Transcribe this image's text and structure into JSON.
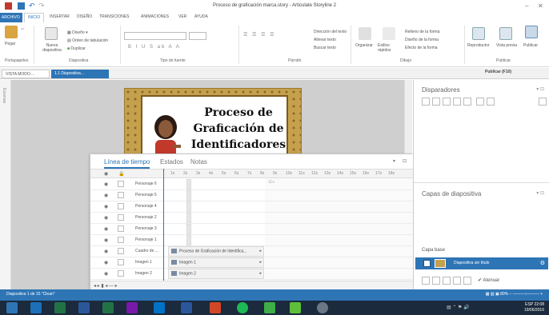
{
  "window": {
    "title": "Proceso de graficación marca.story - Articulate Storyline 2"
  },
  "ribbon_tabs": [
    "ARCHIVO",
    "INICIO",
    "INSERTAR",
    "DISEÑO",
    "TRANSICIONES",
    "ANIMACIONES",
    "VER",
    "AYUDA"
  ],
  "ribbon": {
    "pegar": "Pegar",
    "nueva_diapositiva": "Nueva diapositiva",
    "diseno": "Diseño",
    "orden_tabulacion": "Orden de tabulación",
    "duplicar": "Duplicar",
    "group_portapapeles": "Portapapeles",
    "group_diapositiva": "Diapositiva",
    "group_tipo_fuente": "Tipo de fuente",
    "group_parrafo": "Párrafo",
    "group_dibujo": "Dibujo",
    "group_publicar": "Publicar",
    "direccion_texto": "Dirección del texto",
    "alinear_texto": "Alinear texto",
    "buscar_texto": "Buscar texto",
    "organizar": "Organizar",
    "estilos_rapidos": "Estilos rápidos",
    "relleno_forma": "Relleno de la forma",
    "contorno_forma": "Diseño de la forma",
    "efecto_forma": "Efecto de la forma",
    "reproductor": "Reproductor",
    "vista_previa": "Vista previa",
    "publicar": "Publicar",
    "publicar_tooltip": "Publicar (F10)"
  },
  "doc_tabs": {
    "story_view": "VISTA MODO ...",
    "slide": "1.1 Diapositiva..."
  },
  "left_strip_label": "Escenas",
  "slide": {
    "title": "Proceso de Graficación de Identificadores"
  },
  "timeline": {
    "tabs": [
      "Línea de tiempo",
      "Estados",
      "Notas"
    ],
    "ruler": [
      "1s",
      "2s",
      "3s",
      "4s",
      "5s",
      "6s",
      "7s",
      "8s",
      "9s",
      "10s",
      "11s",
      "12s",
      "13s",
      "14s",
      "15s",
      "16s",
      "17s",
      "18s"
    ],
    "end_label": "11s",
    "rows": [
      {
        "name": "Personaje 6",
        "bar": ""
      },
      {
        "name": "Personaje 5",
        "bar": ""
      },
      {
        "name": "Personaje 4",
        "bar": ""
      },
      {
        "name": "Personaje 2",
        "bar": ""
      },
      {
        "name": "Personaje 3",
        "bar": ""
      },
      {
        "name": "Personaje 1",
        "bar": ""
      },
      {
        "name": "Cuadro de ...",
        "bar": "Proceso de Graficación de Identifica..."
      },
      {
        "name": "Imagen 1",
        "bar": "Imagen 1"
      },
      {
        "name": "Imagen 2",
        "bar": "Imagen 2"
      }
    ]
  },
  "right_panel": {
    "triggers_title": "Disparadores",
    "layers_title": "Capas de diapositiva",
    "base_layer_label": "Capa base",
    "base_layer_name": "Diapositiva sin título",
    "atenuar": "Atenuar"
  },
  "statusbar": {
    "left": "Diapositiva 1 de 15   \"Clean\"",
    "zoom": "80%"
  },
  "taskbar": {
    "lang": "ESP",
    "time": "22:08",
    "date": "19/06/2016"
  },
  "colors": {
    "accent": "#2e75b6",
    "taskbar": "#1b2a3c",
    "slide_frame": "#c5a04d"
  }
}
